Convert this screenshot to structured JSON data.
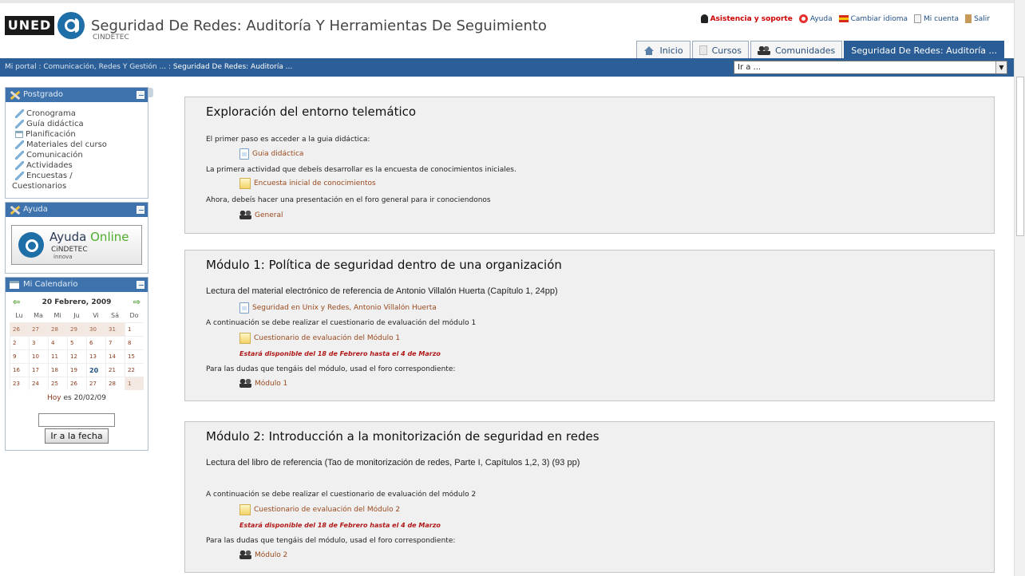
{
  "header": {
    "logo_uned": "UNED",
    "logo_cindetec": "CINDETEC",
    "title": "Seguridad De Redes: Auditoría Y Herramientas De Seguimiento",
    "links": {
      "support": "Asistencia y soporte",
      "help": "Ayuda",
      "language": "Cambiar idioma",
      "account": "Mi cuenta",
      "logout": "Salir"
    },
    "tabs": {
      "home": "Inicio",
      "courses": "Cursos",
      "communities": "Comunidades",
      "current": "Seguridad De Redes: Auditoría ..."
    }
  },
  "navbar": {
    "breadcrumb_prefix": "Mi portal : Comunicación, Redes Y Gestión ... : ",
    "breadcrumb_current": "Seguridad De Redes: Auditoría ...",
    "jump_select": "Ir a ..."
  },
  "sidebar": {
    "postgrado": {
      "title": "Postgrado",
      "items": {
        "cronograma": "Cronograma",
        "guia": "Guía didáctica",
        "planificacion": "Planificación",
        "materiales": "Materiales del curso",
        "comunicacion": "Comunicación",
        "actividades": "Actividades",
        "encuestas": "Encuestas /",
        "cuestionarios": "Cuestionarios"
      }
    },
    "ayuda": {
      "title": "Ayuda",
      "banner_ayuda": "Ayuda",
      "banner_online": "Online",
      "banner_brand": "CiNDETEC",
      "banner_sub": "innova"
    },
    "calendar": {
      "title": "Mi Calendario",
      "month": "20 Febrero, 2009",
      "prev": "⇦",
      "next": "⇨",
      "weekdays": [
        "Lu",
        "Ma",
        "Mi",
        "Ju",
        "Vi",
        "Sá",
        "Do"
      ],
      "days": [
        "26",
        "27",
        "28",
        "29",
        "30",
        "31",
        "1",
        "2",
        "3",
        "4",
        "5",
        "6",
        "7",
        "8",
        "9",
        "10",
        "11",
        "12",
        "13",
        "14",
        "15",
        "16",
        "17",
        "18",
        "19",
        "20",
        "21",
        "22",
        "23",
        "24",
        "25",
        "26",
        "27",
        "28",
        "1"
      ],
      "today_label": "Hoy",
      "today_value": "es 20/02/09",
      "go_button": "Ir a la fecha"
    }
  },
  "sections": {
    "s0": {
      "title": "Exploración del entorno telemático",
      "line1": "El primer paso es acceder a la guia didáctica:",
      "res1": "Guia didáctica",
      "line2": "La primera actividad que debeís desarrollar es la encuesta de conocimientos iniciales.",
      "res2": "Encuesta inicial de conocimientos",
      "line3": "Ahora, debeís hacer una presentación en el foro general para ir conociendonos",
      "res3": "General"
    },
    "s1": {
      "number": "1",
      "title": "Módulo 1: Política de seguridad dentro de una organización",
      "lead": "Lectura del material electrónico de referencia de Antonio Villalón Huerta (Capítulo 1, 24pp)",
      "res1": "Seguridad en Unix y Redes, Antonio Villalón Huerta",
      "line2": "A continuación se debe realizar el cuestionario de evaluación del módulo 1",
      "res2": "Cuestionario de evaluación del Módulo 1",
      "availability": "Estará disponible del 18 de Febrero hasta el 4 de Marzo",
      "line3": "Para las dudas que tengáis del módulo, usad el foro correspondiente:",
      "res3": "Módulo 1"
    },
    "s2": {
      "number": "2",
      "title": "Módulo 2: Introducción a la monitorización de seguridad en redes",
      "lead": "Lectura del libro de referencia (Tao de monitorización de redes, Parte I, Capítulos 1,2, 3) (93 pp)",
      "line2": "A continuación se debe realizar el cuestionario de evaluación del módulo 2",
      "res2": "Cuestionario de evaluación del Módulo 2",
      "availability": "Estará disponible del 18 de Febrero hasta el 4 de Marzo",
      "line3": "Para las dudas que tengáis del módulo, usad el foro correspondiente:",
      "res3": "Módulo 2"
    }
  },
  "colors": {
    "navbar": "#2c5f97",
    "link": "#9a4a1e",
    "alert": "#b01818",
    "section_bg": "#f0f0f0"
  }
}
